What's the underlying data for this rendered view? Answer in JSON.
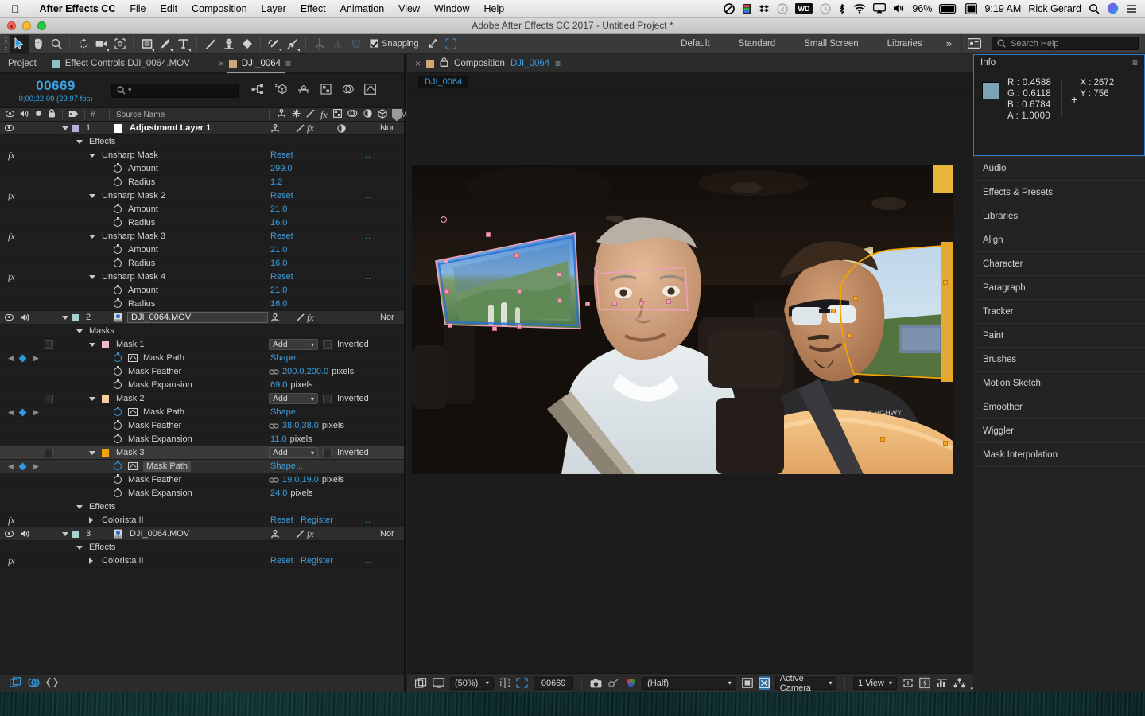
{
  "os_menu": {
    "apple": "apple-logo",
    "items": [
      "After Effects CC",
      "File",
      "Edit",
      "Composition",
      "Layer",
      "Effect",
      "Animation",
      "View",
      "Window",
      "Help"
    ],
    "status": {
      "battery_percent": "96%",
      "time": "9:19 AM",
      "user": "Rick Gerard"
    }
  },
  "window": {
    "title": "Adobe After Effects CC 2017 - Untitled Project *"
  },
  "toolbar": {
    "snapping_label": "Snapping",
    "workspaces": [
      "Default",
      "Standard",
      "Small Screen",
      "Libraries"
    ],
    "overflow": "»",
    "search_placeholder": "Search Help"
  },
  "project_panel": {
    "tabs": [
      {
        "label": "Project",
        "active": false
      },
      {
        "label": "Effect Controls DJI_0064.MOV",
        "active": false
      }
    ],
    "timeline_tab": {
      "label": "DJI_0064",
      "close": "×"
    },
    "timecode": "00669",
    "timecode_sub": "0;00;22;09 (29.97 fps)",
    "search_placeholder": "",
    "columns": {
      "number": "#",
      "source_name": "Source Name",
      "mode": "Mode"
    }
  },
  "layers": [
    {
      "index": "1",
      "name": "Adjustment Layer 1",
      "mode": "Nor",
      "type": "adjustment",
      "group": "Effects",
      "effects": [
        {
          "name": "Unsharp Mask",
          "reset": "Reset",
          "more": "...",
          "props": [
            {
              "label": "Amount",
              "value": "299.0"
            },
            {
              "label": "Radius",
              "value": "1.2"
            }
          ]
        },
        {
          "name": "Unsharp Mask 2",
          "reset": "Reset",
          "more": "...",
          "props": [
            {
              "label": "Amount",
              "value": "21.0"
            },
            {
              "label": "Radius",
              "value": "16.0"
            }
          ]
        },
        {
          "name": "Unsharp Mask 3",
          "reset": "Reset",
          "more": "...",
          "props": [
            {
              "label": "Amount",
              "value": "21.0"
            },
            {
              "label": "Radius",
              "value": "16.0"
            }
          ]
        },
        {
          "name": "Unsharp Mask 4",
          "reset": "Reset",
          "more": "...",
          "props": [
            {
              "label": "Amount",
              "value": "21.0"
            },
            {
              "label": "Radius",
              "value": "16.0"
            }
          ]
        }
      ]
    },
    {
      "index": "2",
      "name": "DJI_0064.MOV",
      "mode": "Nor",
      "masks_group": "Masks",
      "masks": [
        {
          "name": "Mask 1",
          "color": "#f3b8c8",
          "mode": "Add",
          "inverted": "Inverted",
          "path_label": "Mask Path",
          "path_value": "Shape...",
          "feather_label": "Mask Feather",
          "feather_value": "200.0,200.0",
          "feather_unit": "pixels",
          "expansion_label": "Mask Expansion",
          "expansion_value": "69.0",
          "expansion_unit": "pixels"
        },
        {
          "name": "Mask 2",
          "color": "#f5cda0",
          "mode": "Add",
          "inverted": "Inverted",
          "path_label": "Mask Path",
          "path_value": "Shape...",
          "feather_label": "Mask Feather",
          "feather_value": "38.0,38.0",
          "feather_unit": "pixels",
          "expansion_label": "Mask Expansion",
          "expansion_value": "11.0",
          "expansion_unit": "pixels"
        },
        {
          "name": "Mask 3",
          "color": "#f5a302",
          "mode": "Add",
          "inverted": "Inverted",
          "path_label": "Mask Path",
          "path_value": "Shape...",
          "feather_label": "Mask Feather",
          "feather_value": "19.0,19.0",
          "feather_unit": "pixels",
          "expansion_label": "Mask Expansion",
          "expansion_value": "24.0",
          "expansion_unit": "pixels"
        }
      ],
      "effects_group": "Effects",
      "effects": [
        {
          "name": "Colorista II",
          "reset": "Reset",
          "register": "Register",
          "more": "..."
        }
      ]
    },
    {
      "index": "3",
      "name": "DJI_0064.MOV",
      "mode": "Nor",
      "effects_group": "Effects",
      "effects": [
        {
          "name": "Colorista II",
          "reset": "Reset",
          "register": "Register",
          "more": "..."
        }
      ]
    }
  ],
  "composition": {
    "title_prefix": "Composition",
    "title_name": "DJI_0064",
    "breadcrumb": "DJI_0064",
    "close": "×",
    "viewer_bar": {
      "zoom": "(50%)",
      "timecode": "00669",
      "resolution": "(Half)",
      "camera": "Active Camera",
      "views": "1 View"
    }
  },
  "info_panel": {
    "title": "Info",
    "swatch_color": "#7ba3b3",
    "channels": [
      {
        "label": "R :",
        "value": "0.4588"
      },
      {
        "label": "G :",
        "value": "0.6118"
      },
      {
        "label": "B :",
        "value": "0.6784"
      },
      {
        "label": "A :",
        "value": "1.0000"
      }
    ],
    "coords": [
      {
        "label": "X :",
        "value": "2672"
      },
      {
        "label": "Y :",
        "value": "756"
      }
    ]
  },
  "right_panels": [
    "Audio",
    "Effects & Presets",
    "Libraries",
    "Align",
    "Character",
    "Paragraph",
    "Tracker",
    "Paint",
    "Brushes",
    "Motion Sketch",
    "Smoother",
    "Wiggler",
    "Mask Interpolation"
  ]
}
